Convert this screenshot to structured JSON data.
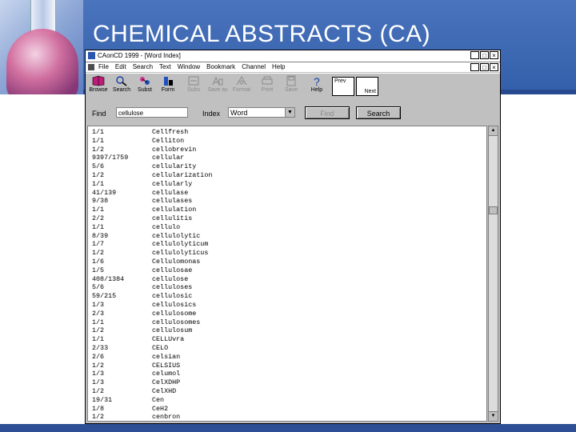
{
  "slide": {
    "title": "CHEMICAL ABSTRACTS (CA)"
  },
  "window": {
    "title": "CAonCD 1999 - [Word Index]",
    "controls": {
      "minimize": "_",
      "maximize": "□",
      "close": "×"
    }
  },
  "menu": {
    "items": [
      "File",
      "Edit",
      "Search",
      "Text",
      "Window",
      "Bookmark",
      "Channel",
      "Help"
    ]
  },
  "toolbar": {
    "buttons": [
      {
        "label": "Browse",
        "icon": "book-icon"
      },
      {
        "label": "Search",
        "icon": "magnifier-icon"
      },
      {
        "label": "Subst",
        "icon": "substance-icon"
      },
      {
        "label": "Form",
        "icon": "flask-icon"
      },
      {
        "label": "Subs",
        "icon": "sub-icon",
        "disabled": true
      },
      {
        "label": "Save as",
        "icon": "save-icon",
        "disabled": true
      },
      {
        "label": "Format",
        "icon": "format-icon",
        "disabled": true
      },
      {
        "label": "Print",
        "icon": "print-icon",
        "disabled": true
      },
      {
        "label": "Save",
        "icon": "disk-icon",
        "disabled": true
      },
      {
        "label": "Help",
        "icon": "help-icon"
      }
    ],
    "prev_label": "Prev",
    "next_label": "Next"
  },
  "find": {
    "find_label": "Find",
    "find_value": "cellulose",
    "index_label": "Index",
    "index_value": "Word",
    "find_button": "Find",
    "search_button": "Search"
  },
  "word_index": [
    {
      "count": "1/1",
      "term": "Cellfresh"
    },
    {
      "count": "1/1",
      "term": "Celliton"
    },
    {
      "count": "1/2",
      "term": "cellobrevin"
    },
    {
      "count": "9397/1759",
      "term": "cellular"
    },
    {
      "count": "5/6",
      "term": "cellularity"
    },
    {
      "count": "1/2",
      "term": "cellularization"
    },
    {
      "count": "1/1",
      "term": "cellularly"
    },
    {
      "count": "41/139",
      "term": "cellulase"
    },
    {
      "count": "9/38",
      "term": "cellulases"
    },
    {
      "count": "1/1",
      "term": "cellulation"
    },
    {
      "count": "2/2",
      "term": "cellulitis"
    },
    {
      "count": "1/1",
      "term": "cellulo"
    },
    {
      "count": "8/39",
      "term": "cellulolytic"
    },
    {
      "count": "1/7",
      "term": "cellulolyticum"
    },
    {
      "count": "1/2",
      "term": "cellulolyticus"
    },
    {
      "count": "1/6",
      "term": "Cellulomonas"
    },
    {
      "count": "1/5",
      "term": "cellulosae"
    },
    {
      "count": "408/1384",
      "term": "cellulose"
    },
    {
      "count": "5/6",
      "term": "celluloses"
    },
    {
      "count": "59/215",
      "term": "cellulosic"
    },
    {
      "count": "1/3",
      "term": "cellulosics"
    },
    {
      "count": "2/3",
      "term": "cellulosome"
    },
    {
      "count": "1/1",
      "term": "cellulosomes"
    },
    {
      "count": "1/2",
      "term": "cellulosum"
    },
    {
      "count": "1/1",
      "term": "CELLUvra"
    },
    {
      "count": "2/33",
      "term": "CELO"
    },
    {
      "count": "2/6",
      "term": "celsian"
    },
    {
      "count": "1/2",
      "term": "CELSIUS"
    },
    {
      "count": "1/3",
      "term": "celumol"
    },
    {
      "count": "1/3",
      "term": "CelXDHP"
    },
    {
      "count": "1/2",
      "term": "CelXHD"
    },
    {
      "count": "19/31",
      "term": "Cen"
    },
    {
      "count": "1/8",
      "term": "CeH2"
    },
    {
      "count": "1/2",
      "term": "cenbron"
    }
  ]
}
